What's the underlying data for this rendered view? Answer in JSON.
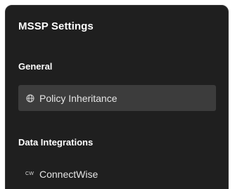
{
  "panel": {
    "title": "MSSP Settings"
  },
  "sections": [
    {
      "heading": "General",
      "items": [
        {
          "label": "Policy Inheritance",
          "icon": "globe-icon",
          "active": true
        }
      ]
    },
    {
      "heading": "Data Integrations",
      "items": [
        {
          "label": "ConnectWise",
          "icon": "connectwise-icon",
          "icon_text": "CW",
          "active": false
        }
      ]
    }
  ],
  "colors": {
    "panel_bg": "#1f1f1f",
    "active_item_bg": "#3c3c3c",
    "text": "#ffffff"
  }
}
